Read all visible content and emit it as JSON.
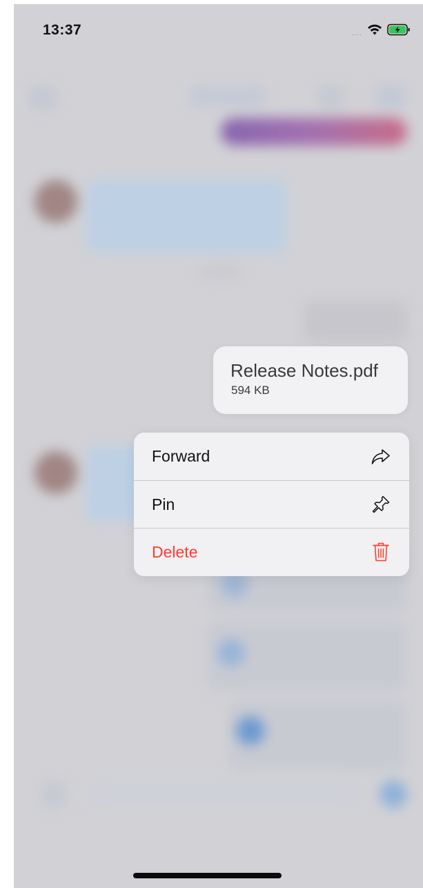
{
  "status_bar": {
    "time": "13:37",
    "signal": "....",
    "wifi_icon": "wifi-icon",
    "battery_icon": "battery-charging-icon",
    "battery_color": "#34c759"
  },
  "file_preview": {
    "name": "Release Notes.pdf",
    "size": "594 KB"
  },
  "context_menu": {
    "items": [
      {
        "label": "Forward",
        "icon": "forward-icon",
        "destructive": false
      },
      {
        "label": "Pin",
        "icon": "pin-icon",
        "destructive": false
      },
      {
        "label": "Delete",
        "icon": "trash-icon",
        "destructive": true
      }
    ],
    "destructive_color": "#ff3b30"
  },
  "colors": {
    "background_dim": "#d2d2d6",
    "menu_background": "#f1f1f3",
    "accent_blue": "#4a90d9"
  }
}
